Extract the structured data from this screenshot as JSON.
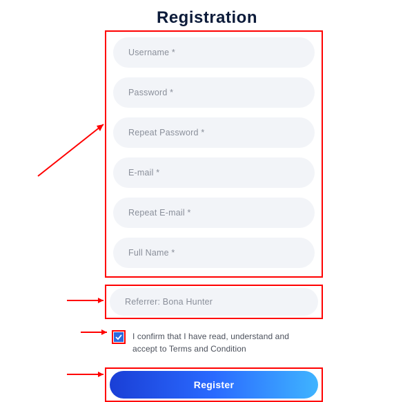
{
  "title": "Registration",
  "fields": {
    "username": "Username *",
    "password": "Password *",
    "repeat_password": "Repeat Password *",
    "email": "E-mail *",
    "repeat_email": "Repeat E-mail *",
    "fullname": "Full Name *"
  },
  "referrer": "Referrer: Bona Hunter",
  "consent": "I confirm that I have read, understand and accept to Terms and Condition",
  "button": "Register",
  "colors": {
    "highlight": "#ff0000",
    "accent_start": "#1a3fd6",
    "accent_end": "#3fb4ff",
    "input_bg": "#f2f4f8"
  }
}
